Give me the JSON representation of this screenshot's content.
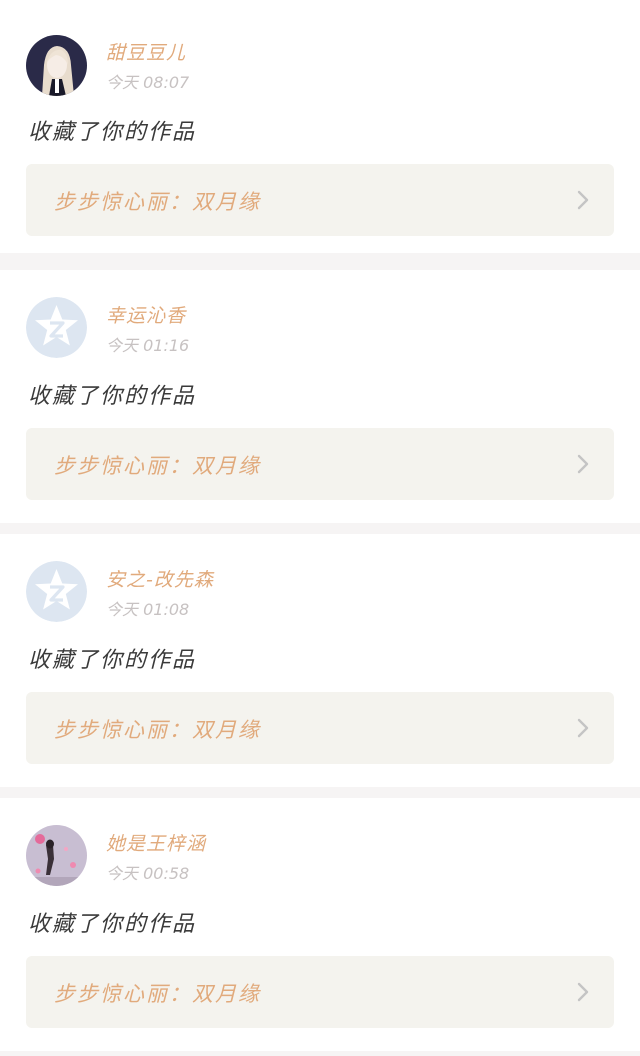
{
  "notifications": [
    {
      "user": "甜豆豆儿",
      "time": "今天 08:07",
      "avatar": "photo-avatar-girl",
      "action": "收藏了你的作品",
      "work_title": "步步惊心丽：双月缘"
    },
    {
      "user": "幸运沁香",
      "time": "今天 01:16",
      "avatar": "default-star-avatar",
      "action": "收藏了你的作品",
      "work_title": "步步惊心丽：双月缘"
    },
    {
      "user": "安之-改先森",
      "time": "今天 01:08",
      "avatar": "default-star-avatar",
      "action": "收藏了你的作品",
      "work_title": "步步惊心丽：双月缘"
    },
    {
      "user": "她是王梓涵",
      "time": "今天 00:58",
      "avatar": "photo-avatar-hearts",
      "action": "收藏了你的作品",
      "work_title": "步步惊心丽：双月缘"
    }
  ],
  "colors": {
    "accent": "#e1aa7c",
    "timestamp": "#c7c2c2",
    "body_text": "#3a3a3a",
    "link_bg": "#f4f3ee",
    "page_bg": "#f6f4f4"
  }
}
